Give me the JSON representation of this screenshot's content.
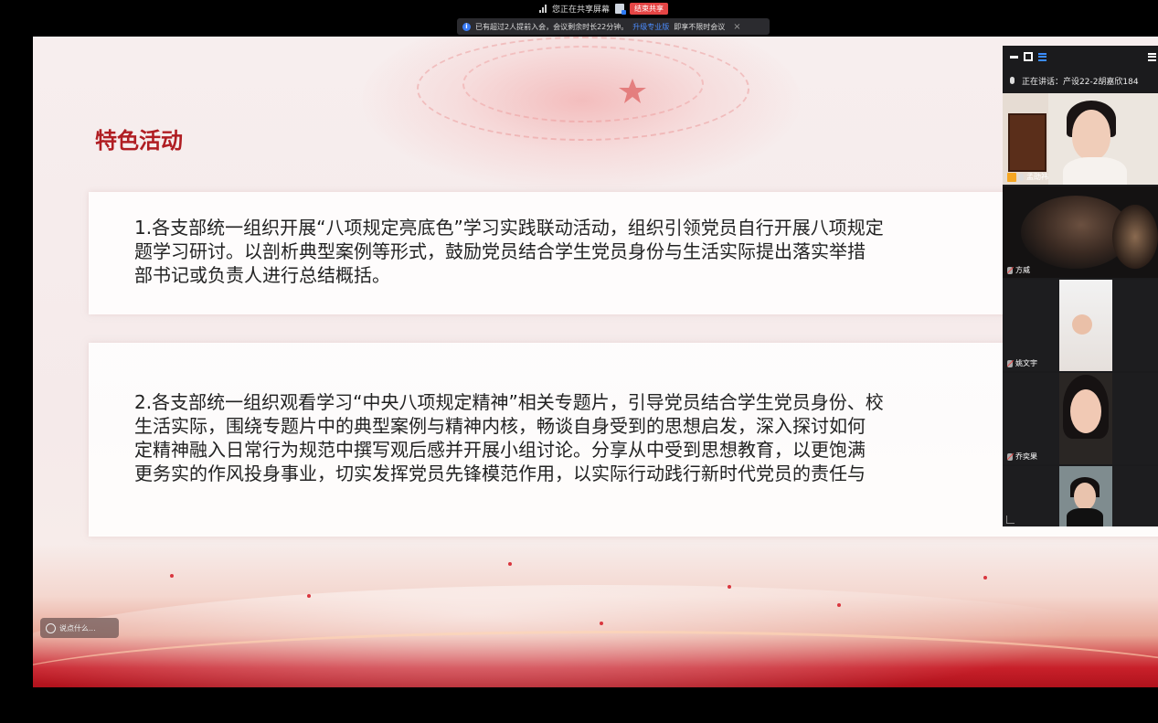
{
  "share_bar": {
    "sharing_text": "您正在共享屏幕",
    "stop_label": "结束共享"
  },
  "notice": {
    "text_before": "已有超过2人提前入会，会议剩余时长22分钟。",
    "upgrade_link": "升级专业版",
    "text_after": "即享不限时会议",
    "close": "×"
  },
  "slide": {
    "title": "特色活动",
    "item1": [
      "1.各支部统一组织开展“八项规定亮底色”学习实践联动活动，组织引领党员自行开展八项规定",
      "题学习研讨。以剖析典型案例等形式，鼓励党员结合学生党员身份与生活实际提出落实举措",
      "部书记或负责人进行总结概括。"
    ],
    "item2": [
      "2.各支部统一组织观看学习“中央八项规定精神”相关专题片，引导党员结合学生党员身份、校",
      "生活实际，围绕专题片中的典型案例与精神内核，畅谈自身受到的思想启发，深入探讨如何",
      "定精神融入日常行为规范中撰写观后感并开展小组讨论。分享从中受到思想教育，以更饱满",
      "更务实的作风投身事业，切实发挥党员先锋模范作用，以实际行动践行新时代党员的责任与"
    ]
  },
  "chat_input": {
    "placeholder": "说点什么..."
  },
  "video_panel": {
    "speaking_label": "正在讲话：产设22-2胡嘉欣184",
    "participants": [
      {
        "name": "孟劭祎"
      },
      {
        "name": "方威"
      },
      {
        "name": "姚文宇"
      },
      {
        "name": "乔奕果"
      },
      {
        "name": ""
      }
    ]
  },
  "colors": {
    "title_red": "#b01d22",
    "stop_red": "#e54545",
    "link_blue": "#4c8dff"
  }
}
